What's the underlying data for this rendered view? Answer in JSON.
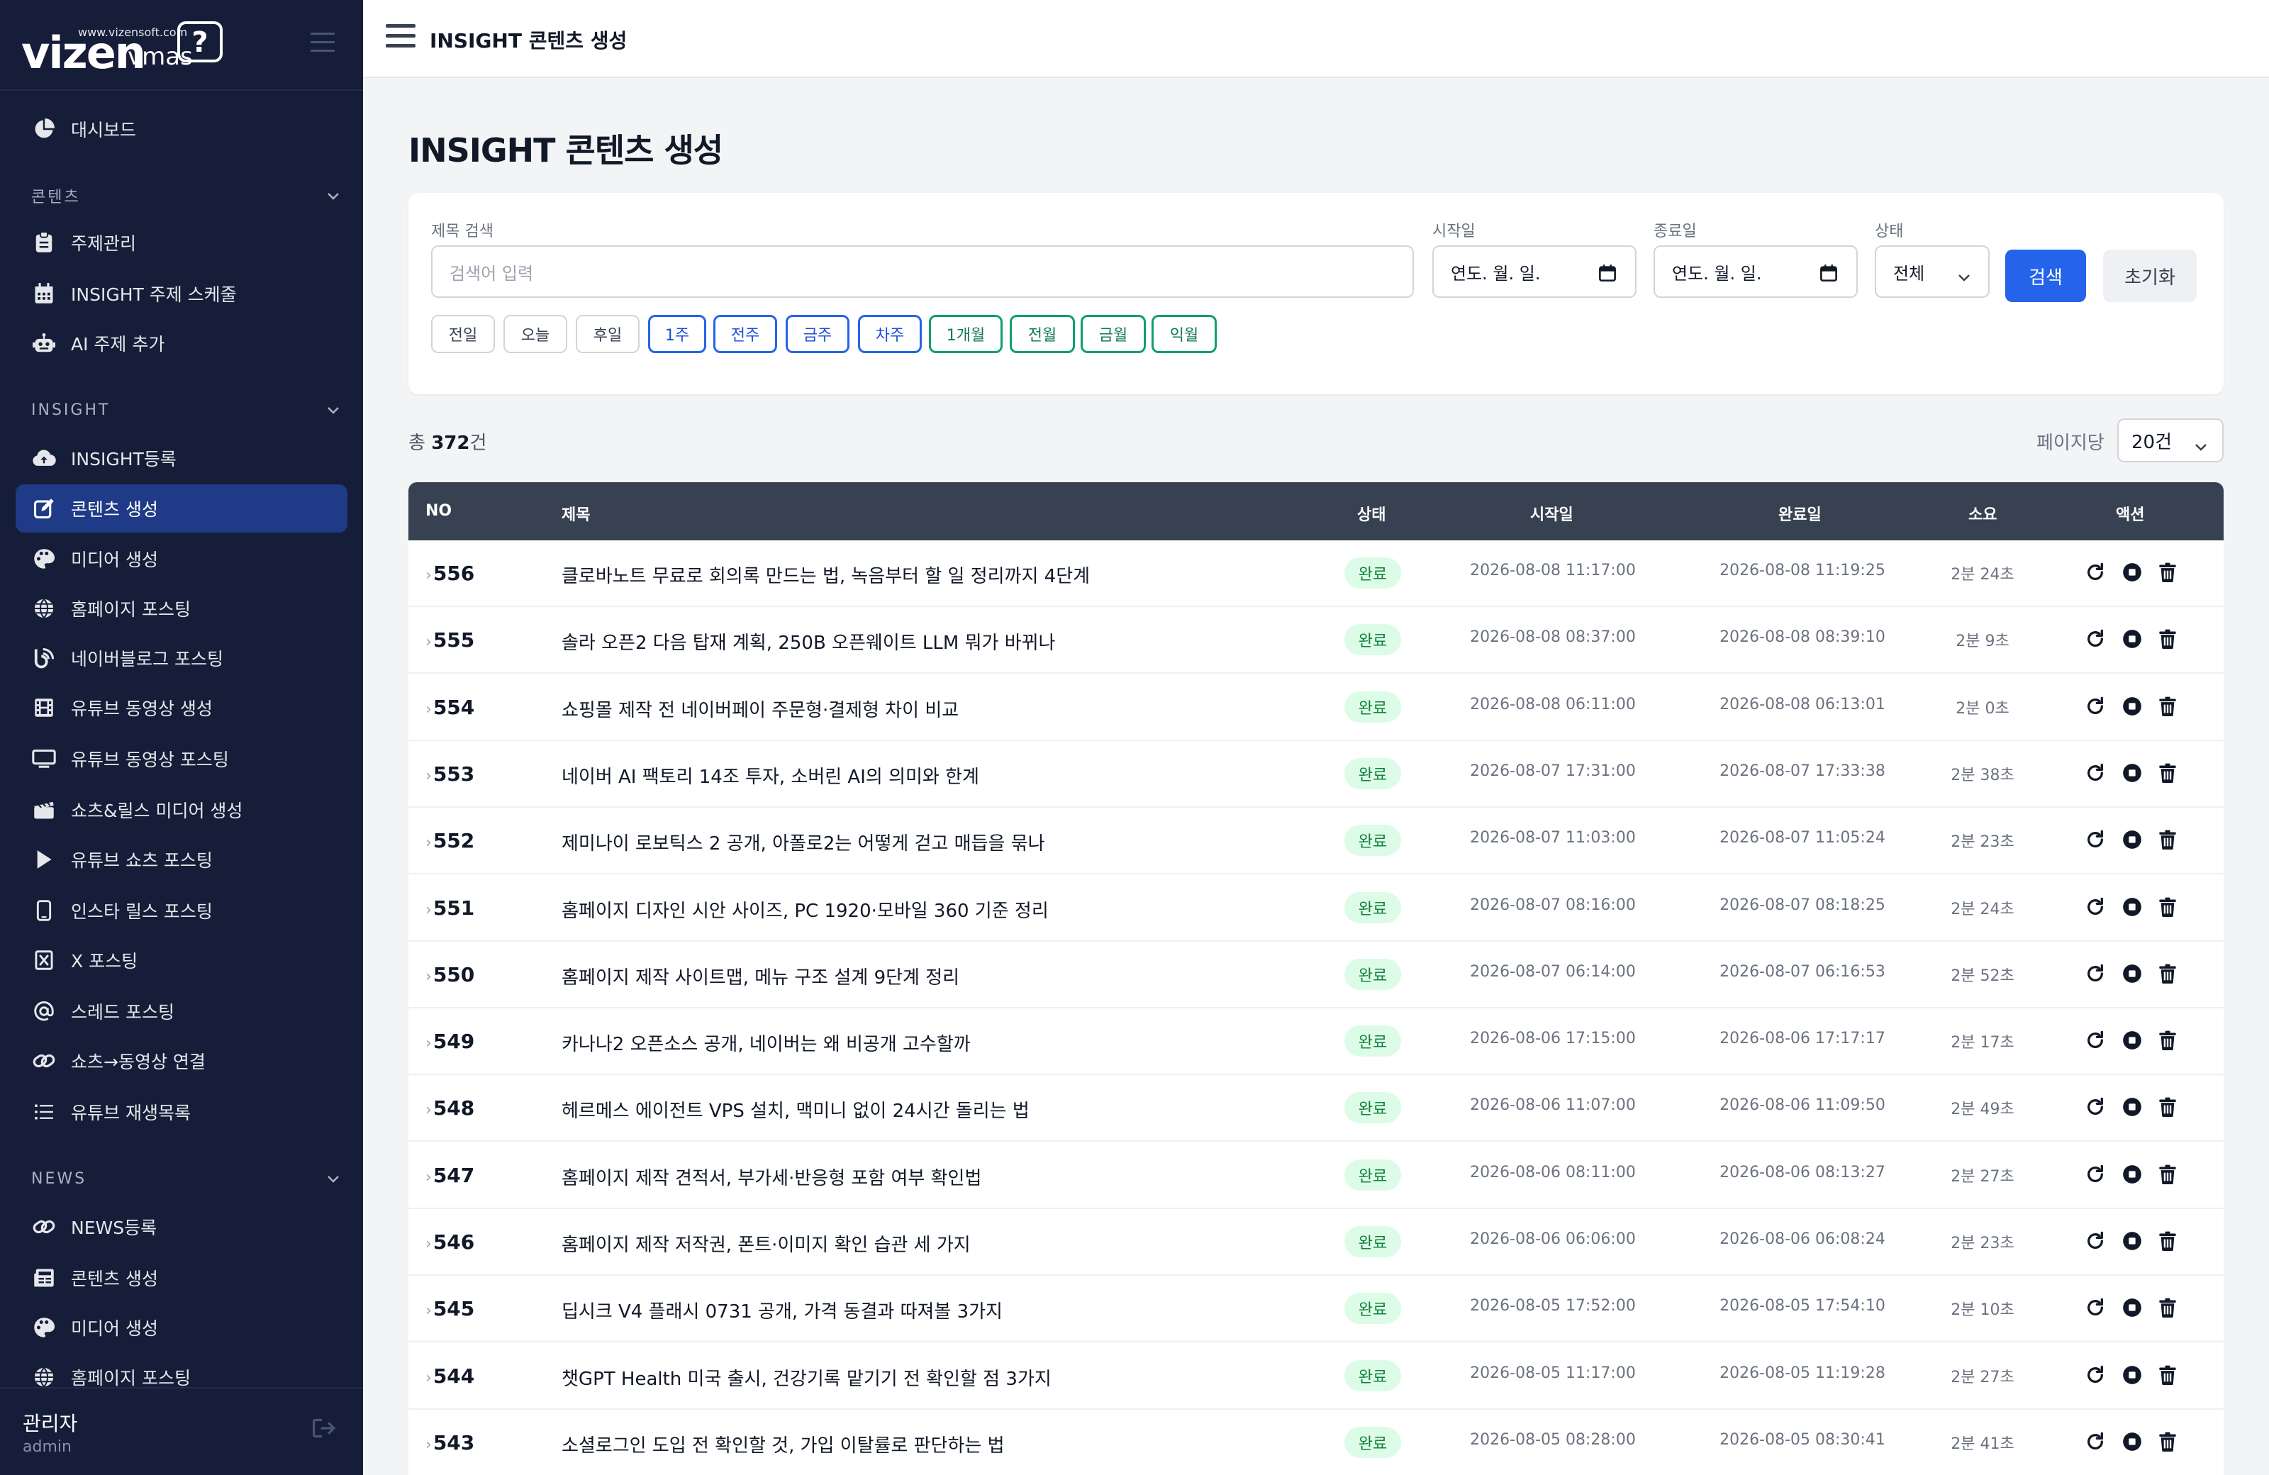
{
  "brand": {
    "url": "www.vizensoft.com",
    "name": "vizen",
    "suffix": "vmas",
    "bubble": "?"
  },
  "topbar": {
    "title": "INSIGHT 콘텐츠 생성"
  },
  "page": {
    "title": "INSIGHT 콘텐츠 생성"
  },
  "sidebar": {
    "dashboard": "대시보드",
    "sections": [
      {
        "label": "콘텐츠"
      },
      {
        "label": "INSIGHT"
      },
      {
        "label": "NEWS"
      }
    ],
    "items": [
      {
        "label": "주제관리",
        "icon": "clipboard-icon"
      },
      {
        "label": "INSIGHT 주제 스케줄",
        "icon": "calendar-icon"
      },
      {
        "label": "AI 주제 추가",
        "icon": "robot-icon"
      },
      {
        "label": "INSIGHT등록",
        "icon": "cloud-upload-icon"
      },
      {
        "label": "콘텐츠 생성",
        "icon": "edit-icon"
      },
      {
        "label": "미디어 생성",
        "icon": "palette-icon"
      },
      {
        "label": "홈페이지 포스팅",
        "icon": "globe-icon"
      },
      {
        "label": "네이버블로그 포스팅",
        "icon": "blog-icon"
      },
      {
        "label": "유튜브 동영상 생성",
        "icon": "film-icon"
      },
      {
        "label": "유튜브 동영상 포스팅",
        "icon": "monitor-icon"
      },
      {
        "label": "쇼츠&릴스 미디어 생성",
        "icon": "clapper-icon"
      },
      {
        "label": "유튜브 쇼츠 포스팅",
        "icon": "play-icon"
      },
      {
        "label": "인스타 릴스 포스팅",
        "icon": "phone-icon"
      },
      {
        "label": "X 포스팅",
        "icon": "x-icon"
      },
      {
        "label": "스레드 포스팅",
        "icon": "at-icon"
      },
      {
        "label": "쇼츠→동영상 연결",
        "icon": "link-icon"
      },
      {
        "label": "유튜브 재생목록",
        "icon": "list-icon"
      },
      {
        "label": "NEWS등록",
        "icon": "link-icon"
      },
      {
        "label": "콘텐츠 생성",
        "icon": "newspaper-icon"
      },
      {
        "label": "미디어 생성",
        "icon": "palette-icon"
      },
      {
        "label": "홈페이지 포스팅",
        "icon": "globe-icon"
      }
    ],
    "user": {
      "name": "관리자",
      "role": "admin"
    }
  },
  "filter": {
    "title_label": "제목 검색",
    "title_placeholder": "검색어 입력",
    "start_label": "시작일",
    "start_value": "연도. 월. 일.",
    "end_label": "종료일",
    "end_value": "연도. 월. 일.",
    "status_label": "상태",
    "status_value": "전체",
    "search_button": "검색",
    "reset_button": "초기화",
    "chips": [
      "전일",
      "오늘",
      "후일",
      "1주",
      "전주",
      "금주",
      "차주",
      "1개월",
      "전월",
      "금월",
      "익월"
    ]
  },
  "summary": {
    "prefix": "총 ",
    "count": "372",
    "suffix": "건",
    "perpage_label": "페이지당",
    "perpage_value": "20건"
  },
  "table": {
    "headers": [
      "NO",
      "제목",
      "상태",
      "시작일",
      "완료일",
      "소요",
      "액션"
    ],
    "rows": [
      {
        "no": "556",
        "title": "클로바노트 무료로 회의록 만드는 법, 녹음부터 할 일 정리까지 4단계",
        "status": "완료",
        "start": "2026-08-08 11:17:00",
        "end": "2026-08-08 11:19:25",
        "dur": "2분 24초"
      },
      {
        "no": "555",
        "title": "솔라 오픈2 다음 탑재 계획, 250B 오픈웨이트 LLM 뭐가 바뀌나",
        "status": "완료",
        "start": "2026-08-08 08:37:00",
        "end": "2026-08-08 08:39:10",
        "dur": "2분 9초"
      },
      {
        "no": "554",
        "title": "쇼핑몰 제작 전 네이버페이 주문형·결제형 차이 비교",
        "status": "완료",
        "start": "2026-08-08 06:11:00",
        "end": "2026-08-08 06:13:01",
        "dur": "2분 0초"
      },
      {
        "no": "553",
        "title": "네이버 AI 팩토리 14조 투자, 소버린 AI의 의미와 한계",
        "status": "완료",
        "start": "2026-08-07 17:31:00",
        "end": "2026-08-07 17:33:38",
        "dur": "2분 38초"
      },
      {
        "no": "552",
        "title": "제미나이 로보틱스 2 공개, 아폴로2는 어떻게 걷고 매듭을 묶나",
        "status": "완료",
        "start": "2026-08-07 11:03:00",
        "end": "2026-08-07 11:05:24",
        "dur": "2분 23초"
      },
      {
        "no": "551",
        "title": "홈페이지 디자인 시안 사이즈, PC 1920·모바일 360 기준 정리",
        "status": "완료",
        "start": "2026-08-07 08:16:00",
        "end": "2026-08-07 08:18:25",
        "dur": "2분 24초"
      },
      {
        "no": "550",
        "title": "홈페이지 제작 사이트맵, 메뉴 구조 설계 9단계 정리",
        "status": "완료",
        "start": "2026-08-07 06:14:00",
        "end": "2026-08-07 06:16:53",
        "dur": "2분 52초"
      },
      {
        "no": "549",
        "title": "카나나2 오픈소스 공개, 네이버는 왜 비공개 고수할까",
        "status": "완료",
        "start": "2026-08-06 17:15:00",
        "end": "2026-08-06 17:17:17",
        "dur": "2분 17초"
      },
      {
        "no": "548",
        "title": "헤르메스 에이전트 VPS 설치, 맥미니 없이 24시간 돌리는 법",
        "status": "완료",
        "start": "2026-08-06 11:07:00",
        "end": "2026-08-06 11:09:50",
        "dur": "2분 49초"
      },
      {
        "no": "547",
        "title": "홈페이지 제작 견적서, 부가세·반응형 포함 여부 확인법",
        "status": "완료",
        "start": "2026-08-06 08:11:00",
        "end": "2026-08-06 08:13:27",
        "dur": "2분 27초"
      },
      {
        "no": "546",
        "title": "홈페이지 제작 저작권, 폰트·이미지 확인 습관 세 가지",
        "status": "완료",
        "start": "2026-08-06 06:06:00",
        "end": "2026-08-06 06:08:24",
        "dur": "2분 23초"
      },
      {
        "no": "545",
        "title": "딥시크 V4 플래시 0731 공개, 가격 동결과 따져볼 3가지",
        "status": "완료",
        "start": "2026-08-05 17:52:00",
        "end": "2026-08-05 17:54:10",
        "dur": "2분 10초"
      },
      {
        "no": "544",
        "title": "챗GPT Health 미국 출시, 건강기록 맡기기 전 확인할 점 3가지",
        "status": "완료",
        "start": "2026-08-05 11:17:00",
        "end": "2026-08-05 11:19:28",
        "dur": "2분 27초"
      },
      {
        "no": "543",
        "title": "소셜로그인 도입 전 확인할 것, 가입 이탈률로 판단하는 법",
        "status": "완료",
        "start": "2026-08-05 08:28:00",
        "end": "2026-08-05 08:30:41",
        "dur": "2분 41초"
      }
    ]
  },
  "colors": {
    "sidebar_bg": "#161d38",
    "active_bg": "#1f3a86",
    "primary": "#2563eb",
    "header_bg": "#374151",
    "badge_bg": "#dcfce7",
    "badge_fg": "#15803d"
  }
}
